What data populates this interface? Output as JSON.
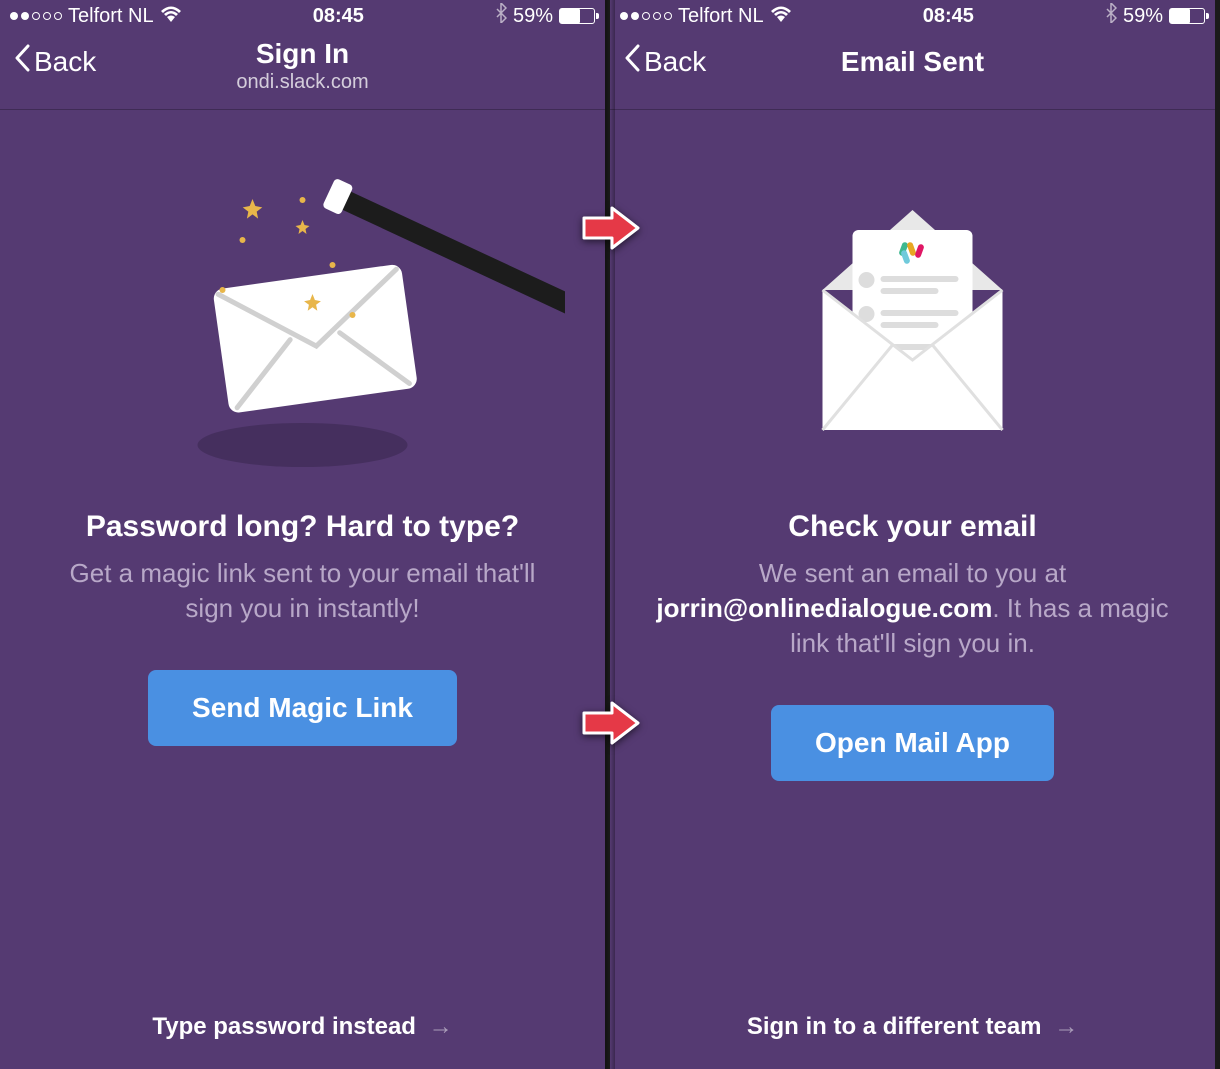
{
  "statusBar": {
    "carrier": "Telfort NL",
    "time": "08:45",
    "batteryPercent": "59%",
    "batteryFill": 59
  },
  "left": {
    "nav": {
      "back": "Back",
      "title": "Sign In",
      "subtitle": "ondi.slack.com"
    },
    "headline": "Password long? Hard to type?",
    "subtext": "Get a magic link sent to your email that'll sign you in instantly!",
    "button": "Send Magic Link",
    "footer": "Type password instead"
  },
  "right": {
    "nav": {
      "back": "Back",
      "title": "Email Sent"
    },
    "headline": "Check your email",
    "subtextPrefix": "We sent an email to you at ",
    "emailAddress": "jorrin@onlinedialogue.com",
    "subtextSuffix": ". It has a magic link that'll sign you in.",
    "button": "Open Mail App",
    "footer": "Sign in to a different team"
  },
  "icons": {
    "wifi": "wifi-icon",
    "bluetooth": "bluetooth-icon",
    "chevronLeft": "chevron-left-icon",
    "arrowRight": "arrow-right-icon"
  }
}
